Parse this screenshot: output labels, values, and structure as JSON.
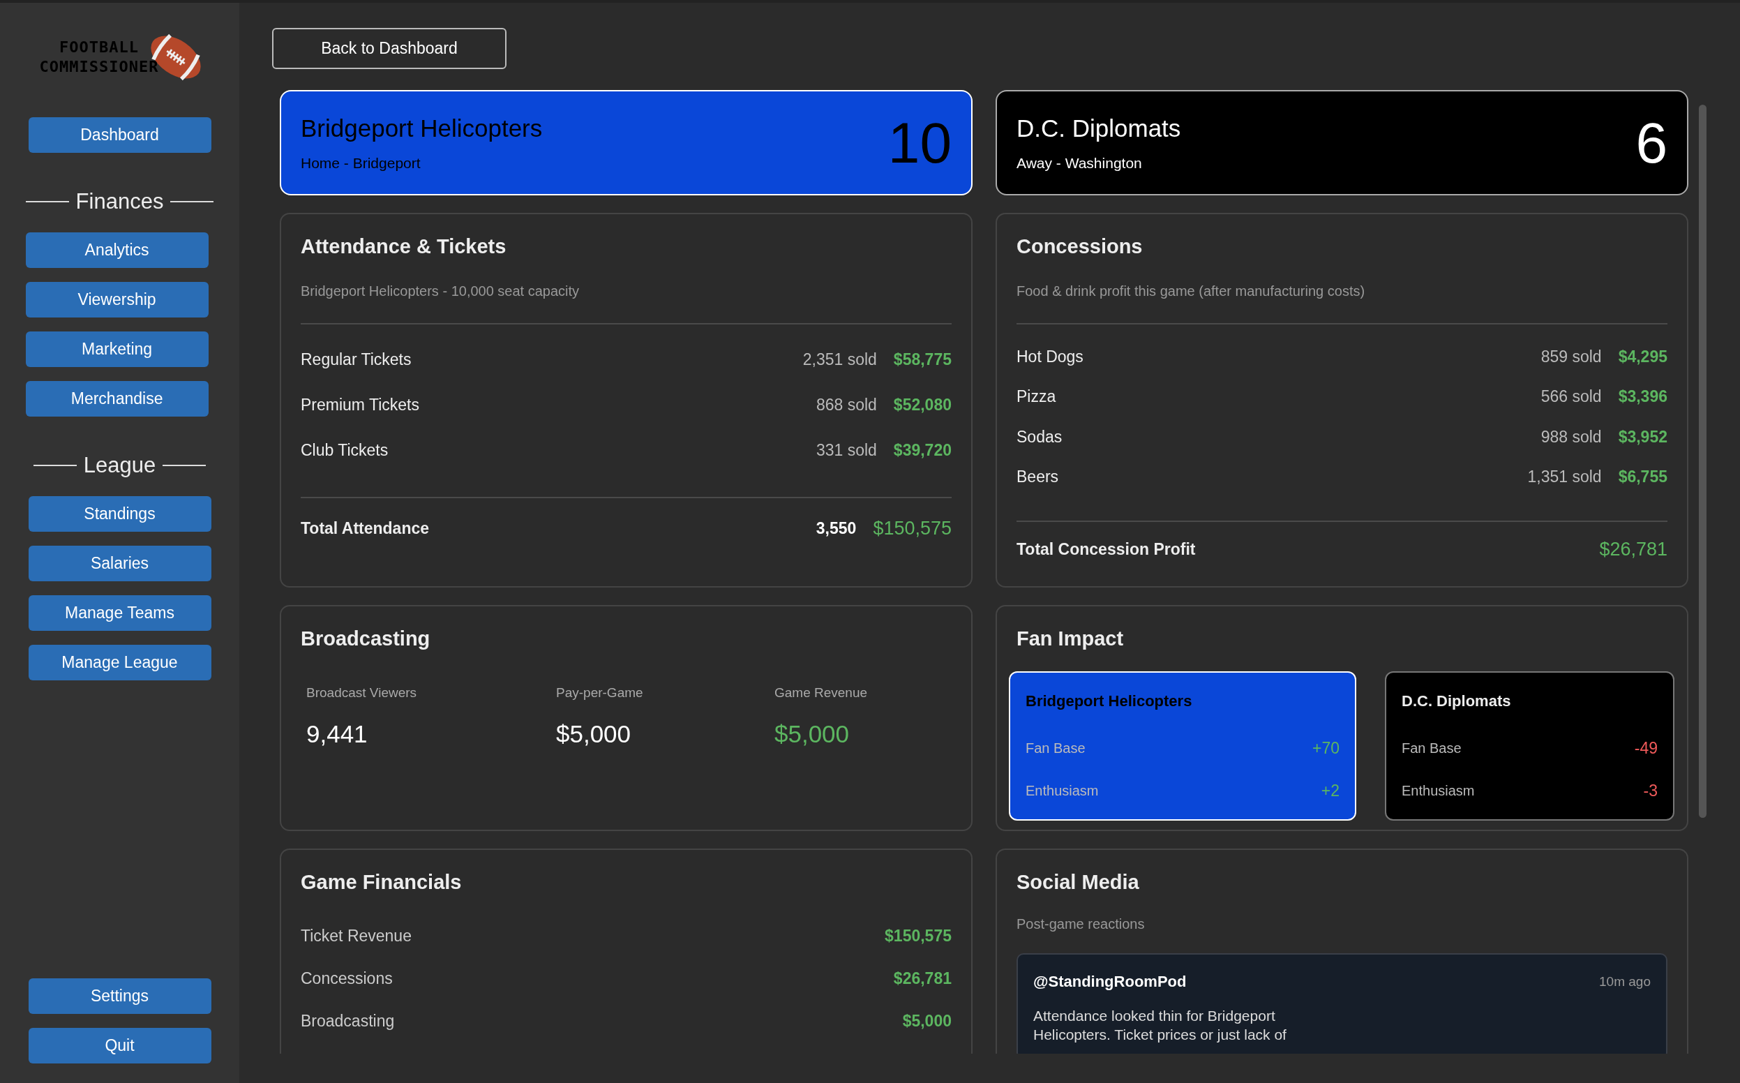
{
  "logo": {
    "lines": [
      "FOOTBALL",
      "COMMISSIONER"
    ]
  },
  "sidebar": {
    "top_items": [
      "Dashboard"
    ],
    "sections": [
      {
        "title": "Finances",
        "items": [
          "Analytics",
          "Viewership",
          "Marketing",
          "Merchandise"
        ]
      },
      {
        "title": "League",
        "items": [
          "Standings",
          "Salaries",
          "Manage Teams",
          "Manage League"
        ]
      }
    ],
    "bottom_items": [
      "Settings",
      "Quit"
    ]
  },
  "back_button": "Back to Dashboard",
  "teams": [
    {
      "kind": "home",
      "name": "Bridgeport Helicopters",
      "subtitle": "Home - Bridgeport",
      "score": "10"
    },
    {
      "kind": "away",
      "name": "D.C. Diplomats",
      "subtitle": "Away - Washington",
      "score": "6"
    }
  ],
  "attendance": {
    "title": "Attendance & Tickets",
    "subtitle": "Bridgeport Helicopters - 10,000 seat capacity",
    "rows": [
      {
        "label": "Regular Tickets",
        "count": "2,351 sold",
        "amount": "$58,775"
      },
      {
        "label": "Premium Tickets",
        "count": "868 sold",
        "amount": "$52,080"
      },
      {
        "label": "Club Tickets",
        "count": "331 sold",
        "amount": "$39,720"
      }
    ],
    "total": {
      "label": "Total Attendance",
      "count": "3,550",
      "amount": "$150,575"
    }
  },
  "concessions": {
    "title": "Concessions",
    "subtitle": "Food & drink profit this game (after manufacturing costs)",
    "rows": [
      {
        "label": "Hot Dogs",
        "count": "859 sold",
        "amount": "$4,295"
      },
      {
        "label": "Pizza",
        "count": "566 sold",
        "amount": "$3,396"
      },
      {
        "label": "Sodas",
        "count": "988 sold",
        "amount": "$3,952"
      },
      {
        "label": "Beers",
        "count": "1,351 sold",
        "amount": "$6,755"
      }
    ],
    "total": {
      "label": "Total Concession Profit",
      "amount": "$26,781"
    }
  },
  "broadcasting": {
    "title": "Broadcasting",
    "stats": [
      {
        "label": "Broadcast Viewers",
        "value": "9,441",
        "kind": "plain"
      },
      {
        "label": "Pay-per-Game",
        "value": "$5,000",
        "kind": "plain"
      },
      {
        "label": "Game Revenue",
        "value": "$5,000",
        "kind": "money"
      }
    ]
  },
  "fan_impact": {
    "title": "Fan Impact",
    "teams": [
      {
        "kind": "home",
        "name": "Bridgeport Helicopters",
        "rows": [
          {
            "label": "Fan Base",
            "value": "+70",
            "color": "#5cb660"
          },
          {
            "label": "Enthusiasm",
            "value": "+2",
            "color": "#5cb660"
          }
        ]
      },
      {
        "kind": "away",
        "name": "D.C. Diplomats",
        "rows": [
          {
            "label": "Fan Base",
            "value": "-49",
            "color": "#f05a5a"
          },
          {
            "label": "Enthusiasm",
            "value": "-3",
            "color": "#f05a5a"
          }
        ]
      }
    ]
  },
  "game_financials": {
    "title": "Game Financials",
    "rows": [
      {
        "label": "Ticket Revenue",
        "value": "$150,575"
      },
      {
        "label": "Concessions",
        "value": "$26,781"
      },
      {
        "label": "Broadcasting",
        "value": "$5,000"
      }
    ]
  },
  "social_media": {
    "title": "Social Media",
    "subtitle": "Post-game reactions",
    "posts": [
      {
        "handle": "@StandingRoomPod",
        "time": "10m ago",
        "text": "Attendance looked thin for Bridgeport Helicopters. Ticket prices or just lack of"
      }
    ]
  }
}
